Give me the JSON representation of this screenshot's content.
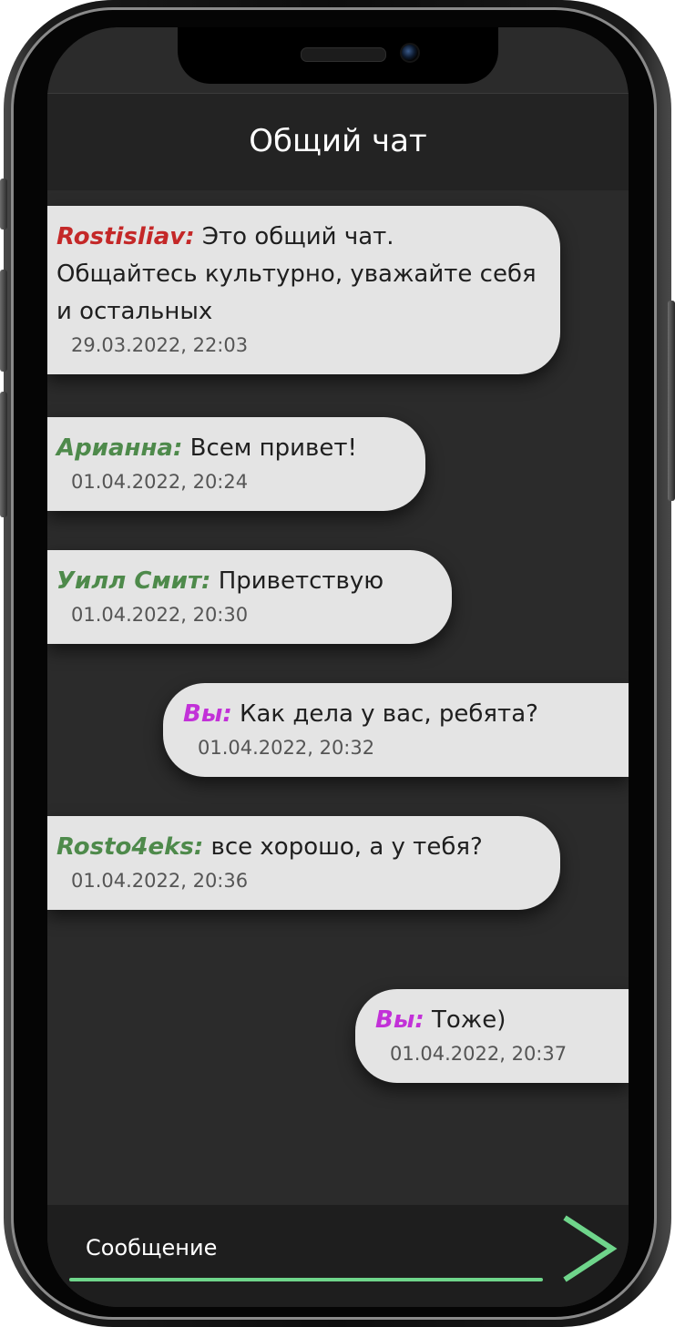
{
  "header": {
    "title": "Общий чат"
  },
  "messages": [
    {
      "sender": "Rostisliav:",
      "text": "Это общий чат. Общайтесь культурно, уважайте себя и остальных",
      "time": "29.03.2022, 22:03"
    },
    {
      "sender": "Арианна:",
      "text": "Всем привет!",
      "time": "01.04.2022, 20:24"
    },
    {
      "sender": "Уилл Смит:",
      "text": "Приветствую",
      "time": "01.04.2022, 20:30"
    },
    {
      "sender": "Вы:",
      "text": "Как дела у вас, ребята?",
      "time": "01.04.2022, 20:32"
    },
    {
      "sender": "Rosto4eks:",
      "text": "все хорошо, а у тебя?",
      "time": "01.04.2022, 20:36"
    },
    {
      "sender": "Вы:",
      "text": "Тоже)",
      "time": "01.04.2022, 20:37"
    }
  ],
  "composer": {
    "placeholder": "Сообщение",
    "value": ""
  },
  "colors": {
    "admin_sender": "#c42828",
    "user_sender": "#4e8a4b",
    "self_sender": "#c231d8",
    "send_icon": "#6fd58b",
    "bubble": "#e4e4e4",
    "screen_bg": "#2b2b2b"
  }
}
